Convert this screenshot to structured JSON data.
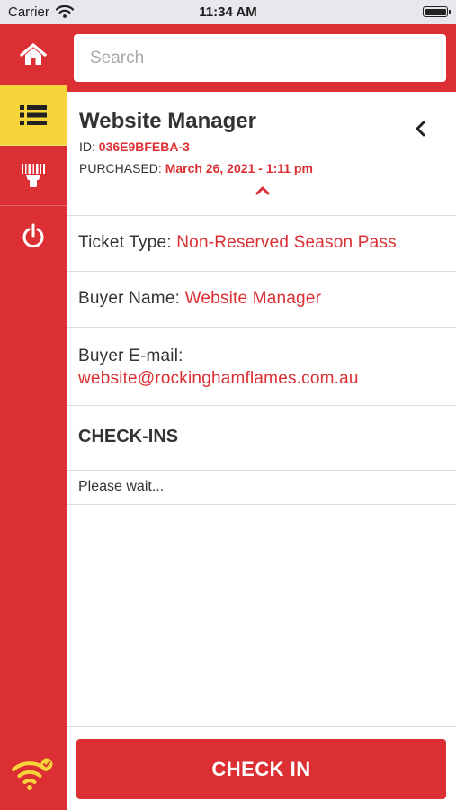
{
  "status_bar": {
    "carrier": "Carrier",
    "time": "11:34 AM",
    "icons": [
      "wifi-icon",
      "battery-icon"
    ]
  },
  "colors": {
    "brand_red": "#dc2f33",
    "active_yellow": "#f7d53a",
    "text_dark": "#333333"
  },
  "sidebar": {
    "items": [
      {
        "icon": "home-icon",
        "active": false
      },
      {
        "icon": "list-icon",
        "active": true
      },
      {
        "icon": "barcode-scanner-icon",
        "active": false
      },
      {
        "icon": "power-icon",
        "active": false
      }
    ],
    "footer_icon": "wifi-connected-icon"
  },
  "search": {
    "placeholder": "Search"
  },
  "ticket": {
    "name": "Website Manager",
    "id_label": "ID:",
    "id_value": "036E9BFEBA-3",
    "purchased_label": "PURCHASED:",
    "purchased_value": "March 26, 2021 - 1:11 pm"
  },
  "details": {
    "ticket_type_label": "Ticket Type:",
    "ticket_type_value": "Non-Reserved Season Pass",
    "buyer_name_label": "Buyer Name:",
    "buyer_name_value": "Website Manager",
    "buyer_email_label": "Buyer E-mail:",
    "buyer_email_value": "website@rockinghamflames.com.au"
  },
  "checkins": {
    "heading": "CHECK-INS",
    "status": "Please wait..."
  },
  "actions": {
    "checkin_label": "CHECK IN"
  }
}
